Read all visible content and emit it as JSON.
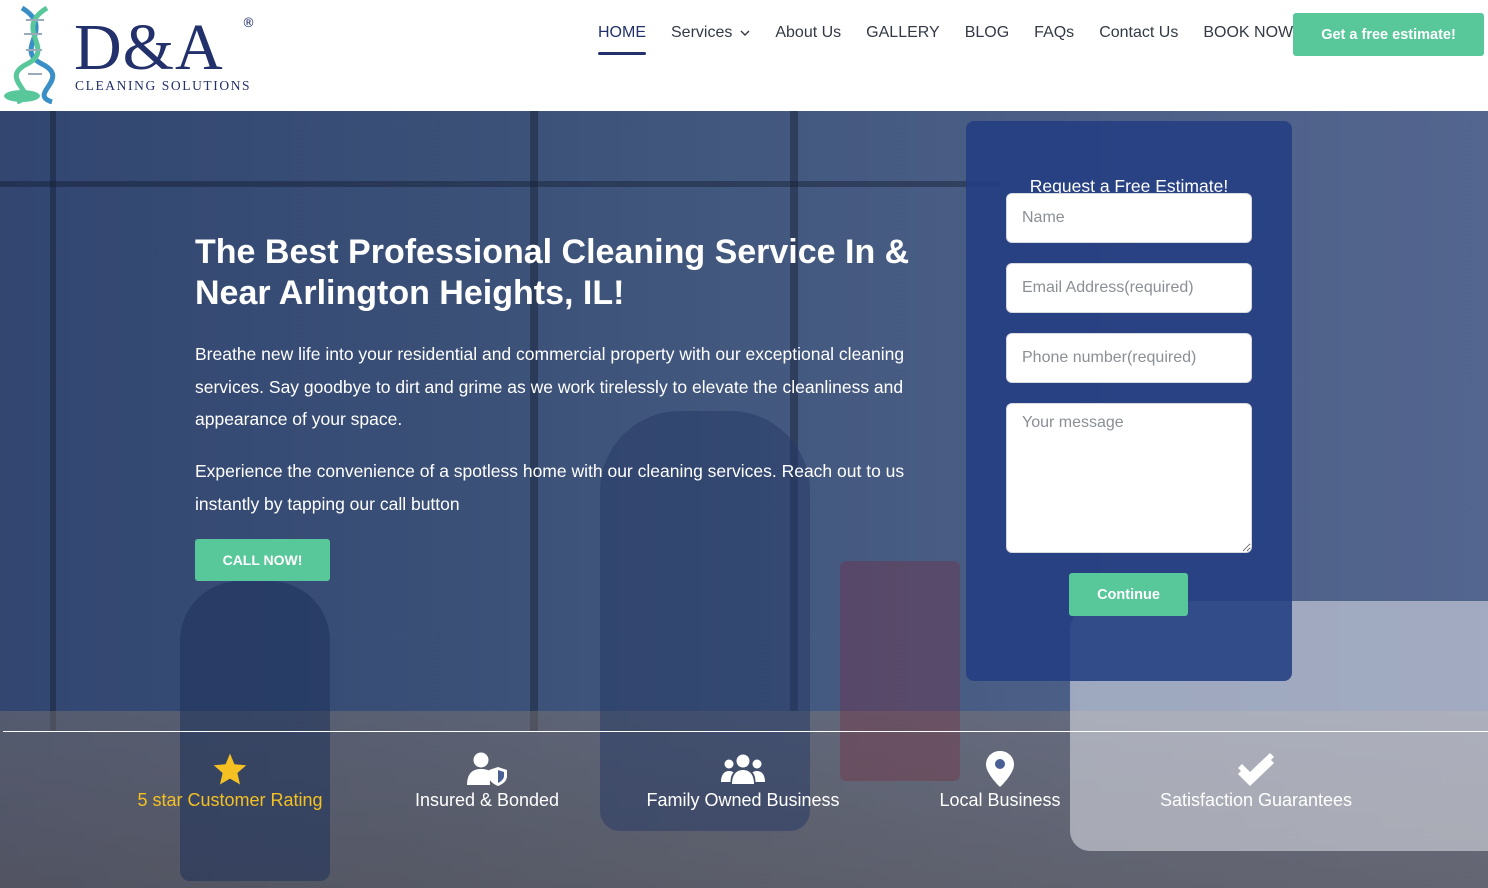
{
  "brand": {
    "name": "D&A",
    "registered": "®",
    "tagline": "CLEANING SOLUTIONS"
  },
  "nav": {
    "items": [
      {
        "label": "HOME",
        "active": true
      },
      {
        "label": "Services",
        "has_dropdown": true
      },
      {
        "label": "About Us"
      },
      {
        "label": "GALLERY"
      },
      {
        "label": "BLOG"
      },
      {
        "label": "FAQs"
      },
      {
        "label": "Contact Us"
      },
      {
        "label": "BOOK NOW"
      }
    ],
    "cta_label": "Get a free estimate!"
  },
  "hero": {
    "title": "The Best Professional Cleaning Service In & Near Arlington Heights, IL!",
    "paragraph1": "Breathe new life into your residential and commercial property with our exceptional cleaning services. Say goodbye to dirt and grime as we work tirelessly to elevate the cleanliness and appearance of your space.",
    "paragraph2": "Experience the convenience of a spotless home with our cleaning services. Reach out to us instantly by tapping our call button",
    "call_label": "CALL NOW!"
  },
  "form": {
    "title": "Request a Free Estimate!",
    "name_placeholder": "Name",
    "email_placeholder": "Email Address(required)",
    "phone_placeholder": "Phone number(required)",
    "message_placeholder": "Your message",
    "submit_label": "Continue"
  },
  "features": [
    {
      "icon": "star-icon",
      "label": "5 star Customer Rating"
    },
    {
      "icon": "user-shield-icon",
      "label": "Insured & Bonded"
    },
    {
      "icon": "users-icon",
      "label": "Family Owned Business"
    },
    {
      "icon": "map-pin-icon",
      "label": "Local Business"
    },
    {
      "icon": "double-check-icon",
      "label": "Satisfaction Guarantees"
    }
  ],
  "colors": {
    "brand_navy": "#22306b",
    "accent_green": "#58c79a",
    "gold": "#f4c022",
    "overlay_blue": "#203870"
  }
}
